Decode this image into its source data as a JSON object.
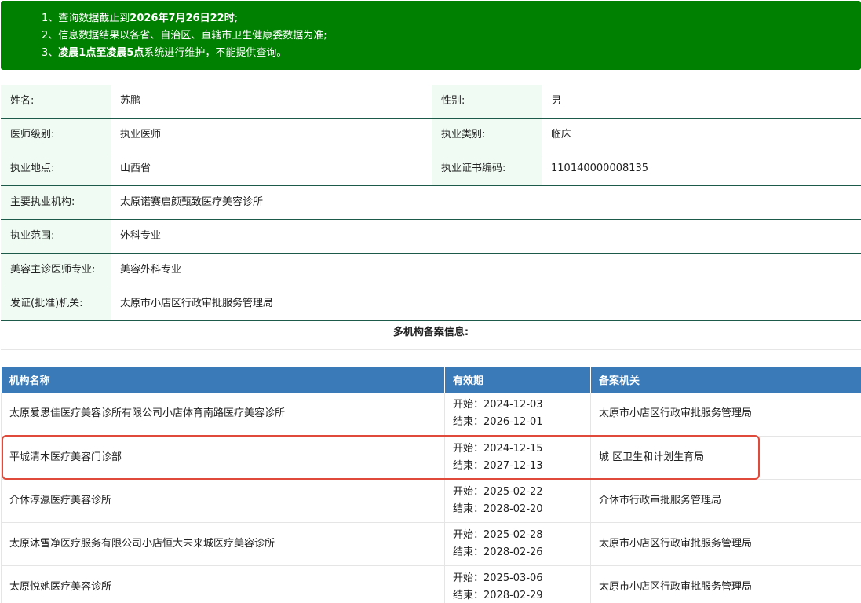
{
  "notice": {
    "line1_a": "1、查询数据截止到",
    "line1_b": "2026年7月26日22时",
    "line1_c": ";",
    "line2": "2、信息数据结果以各省、自治区、直辖市卫生健康委数据为准;",
    "line3_a": "3、",
    "line3_b": "凌晨1点至凌晨5点",
    "line3_c": "系统进行维护，不能提供查询。"
  },
  "info": {
    "name_label": "姓名:",
    "name": "苏鹏",
    "gender_label": "性别:",
    "gender": "男",
    "level_label": "医师级别:",
    "level": "执业医师",
    "category_label": "执业类别:",
    "category": "临床",
    "location_label": "执业地点:",
    "location": "山西省",
    "cert_label": "执业证书编码:",
    "cert": "110140000008135",
    "org_label": "主要执业机构:",
    "org": "太原诺赛启颜甄致医疗美容诊所",
    "scope_label": "执业范围:",
    "scope": "外科专业",
    "beauty_label": "美容主诊医师专业:",
    "beauty": "美容外科专业",
    "issuer_label": "发证(批准)机关:",
    "issuer": "太原市小店区行政审批服务管理局"
  },
  "multi_title": "多机构备案信息:",
  "org_table": {
    "headers": [
      "机构名称",
      "有效期",
      "备案机关"
    ],
    "rows": [
      {
        "name": "太原爱思佳医疗美容诊所有限公司小店体育南路医疗美容诊所",
        "start": "开始：2024-12-03",
        "end": "结束：2026-12-01",
        "agency": "太原市小店区行政审批服务管理局"
      },
      {
        "name": "平城清木医疗美容门诊部",
        "start": "开始：2024-12-15",
        "end": "结束：2027-12-13",
        "agency": "城 区卫生和计划生育局"
      },
      {
        "name": "介休淳瀛医疗美容诊所",
        "start": "开始：2025-02-22",
        "end": "结束：2028-02-20",
        "agency": "介休市行政审批服务管理局"
      },
      {
        "name": "太原沐雪净医疗服务有限公司小店恒大未来城医疗美容诊所",
        "start": "开始：2025-02-28",
        "end": "结束：2028-02-26",
        "agency": "太原市小店区行政审批服务管理局"
      },
      {
        "name": "太原悦她医疗美容诊所",
        "start": "开始：2025-03-06",
        "end": "结束：2028-02-29",
        "agency": "太原市小店区行政审批服务管理局"
      }
    ]
  },
  "colors": {
    "notice_bg": "#008000",
    "header_bg": "#3a7ab8",
    "highlight": "#e04a3a",
    "label_bg": "#f0fcf3"
  }
}
